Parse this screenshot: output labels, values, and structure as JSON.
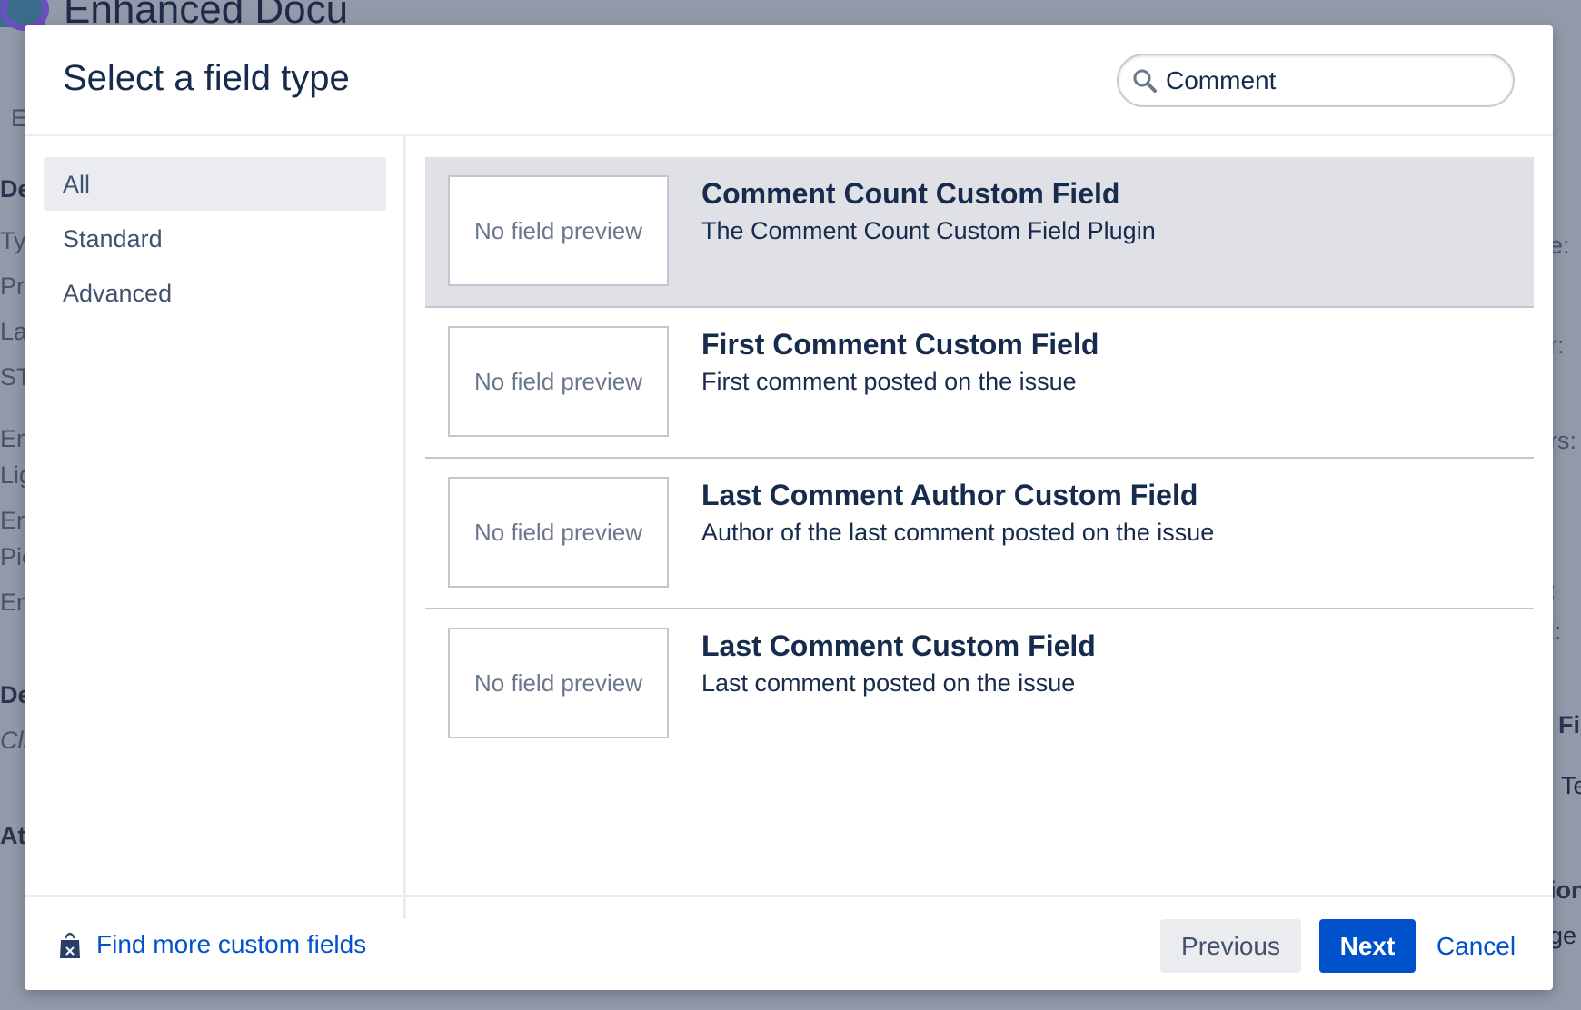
{
  "background": {
    "page_title": "Enhanced Docu",
    "fragments": [
      "E",
      "De",
      "Ty",
      "Pri",
      "La",
      "ST",
      "En",
      "Lig",
      "En",
      "Pic",
      "En",
      "De",
      "Cli",
      "At",
      "e:",
      "r:",
      "rs:",
      ":",
      "l:",
      "Fi",
      "Te",
      "ion",
      "ge"
    ]
  },
  "dialog": {
    "title": "Select a field type",
    "search": {
      "value": "Comment",
      "icon": "search-icon"
    },
    "nav": [
      {
        "label": "All",
        "selected": true
      },
      {
        "label": "Standard",
        "selected": false
      },
      {
        "label": "Advanced",
        "selected": false
      }
    ],
    "fields": [
      {
        "preview": "No field preview",
        "title": "Comment Count Custom Field",
        "description": "The Comment Count Custom Field Plugin",
        "selected": true
      },
      {
        "preview": "No field preview",
        "title": "First Comment Custom Field",
        "description": "First comment posted on the issue",
        "selected": false
      },
      {
        "preview": "No field preview",
        "title": "Last Comment Author Custom Field",
        "description": "Author of the last comment posted on the issue",
        "selected": false
      },
      {
        "preview": "No field preview",
        "title": "Last Comment Custom Field",
        "description": "Last comment posted on the issue",
        "selected": false
      }
    ],
    "footer": {
      "find_more_label": "Find more custom fields",
      "find_more_icon": "marketplace-bag-icon",
      "previous_label": "Previous",
      "next_label": "Next",
      "cancel_label": "Cancel"
    },
    "colors": {
      "primary": "#0052cc",
      "selected_row": "#dfe1e6",
      "text": "#172b4d"
    }
  }
}
